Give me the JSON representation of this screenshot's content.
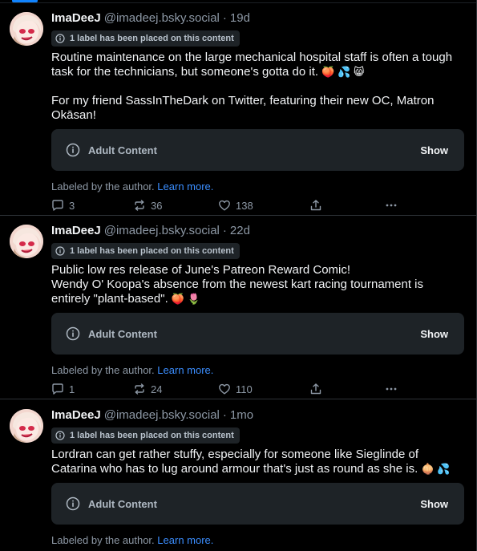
{
  "posts": [
    {
      "display_name": "ImaDeeJ",
      "handle": "@imadeej.bsky.social",
      "dot": "·",
      "age": "19d",
      "label_notice": "1 label has been placed on this content",
      "text": "Routine maintenance on the large mechanical hospital staff is often a tough task for the technicians, but someone's gotta do it.",
      "emojis": "🍑 💦 😸",
      "text2": "For my friend SassInTheDark on Twitter, featuring their new OC, Matron Okāsan!",
      "content_warning": "Adult Content",
      "show_label": "Show",
      "labeled_by": "Labeled by the author.",
      "learn_more": "Learn more.",
      "replies": "3",
      "reposts": "36",
      "likes": "138"
    },
    {
      "display_name": "ImaDeeJ",
      "handle": "@imadeej.bsky.social",
      "dot": "·",
      "age": "22d",
      "label_notice": "1 label has been placed on this content",
      "text": "Public low res release of June's Patreon Reward Comic!\nWendy O' Koopa's absence from the newest kart racing tournament is entirely \"plant-based\".",
      "emojis": "🍑 🌷",
      "content_warning": "Adult Content",
      "show_label": "Show",
      "labeled_by": "Labeled by the author.",
      "learn_more": "Learn more.",
      "replies": "1",
      "reposts": "24",
      "likes": "110"
    },
    {
      "display_name": "ImaDeeJ",
      "handle": "@imadeej.bsky.social",
      "dot": "·",
      "age": "1mo",
      "label_notice": "1 label has been placed on this content",
      "text": "Lordran can get rather stuffy, especially for someone like Sieglinde of Catarina who has to lug around armour that's just as round as she is.",
      "emojis": "🧅 💦",
      "content_warning": "Adult Content",
      "show_label": "Show",
      "labeled_by": "Labeled by the author.",
      "learn_more": "Learn more."
    }
  ],
  "icons": {
    "reply": "reply-icon",
    "repost": "repost-icon",
    "like": "heart-icon",
    "share": "share-icon",
    "more": "more-icon",
    "info": "info-icon"
  },
  "colors": {
    "background": "#000000",
    "card": "#1e2327",
    "accent": "#1083fe",
    "link": "#3b8eff",
    "muted": "#8d98a5"
  }
}
